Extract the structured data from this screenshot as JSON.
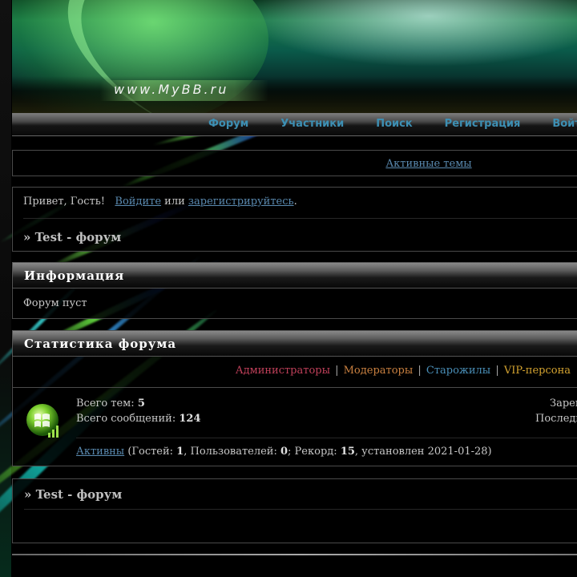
{
  "header": {
    "logo_text": "www.MyBB.ru"
  },
  "nav": {
    "items": [
      "Форум",
      "Участники",
      "Поиск",
      "Регистрация",
      "Войти"
    ]
  },
  "active_topics": {
    "label": "Активные темы"
  },
  "welcome": {
    "greeting": "Привет, Гость!",
    "login_link": "Войдите",
    "or_text": "или",
    "register_link": "зарегистрируйтесь",
    "period": ".",
    "breadcrumb": "» Test - форум"
  },
  "info": {
    "title": "Информация",
    "text": "Форум пуст"
  },
  "stats": {
    "title": "Статистика форума",
    "legend": {
      "admins": "Администраторы",
      "moderators": "Модераторы",
      "oldtimers": "Старожилы",
      "vip": "VIP-персона",
      "separator": "|"
    },
    "total_topics_label": "Всего тем:",
    "total_topics": "5",
    "total_posts_label": "Всего сообщений:",
    "total_posts": "124",
    "right_1": "Зарег",
    "right_2": "Последн",
    "online_link": "Активны",
    "online_guests_label": "(Гостей:",
    "online_guests": "1",
    "online_users_label": ", Пользователей:",
    "online_users": "0",
    "online_record_label": "; Рекорд:",
    "online_record": "15",
    "online_record_date": ", установлен 2021-01-28)"
  },
  "footer": {
    "breadcrumb": "» Test - форум"
  },
  "colors": {
    "background": "#000000",
    "link": "#5a8ab0",
    "nav_link": "#3d8fb3",
    "admin": "#c0405a",
    "moderator": "#c98040",
    "oldtimer": "#4a8fb8",
    "vip": "#d4a330"
  },
  "icons": {
    "stats_icon": "windows-orb-signal-icon"
  }
}
